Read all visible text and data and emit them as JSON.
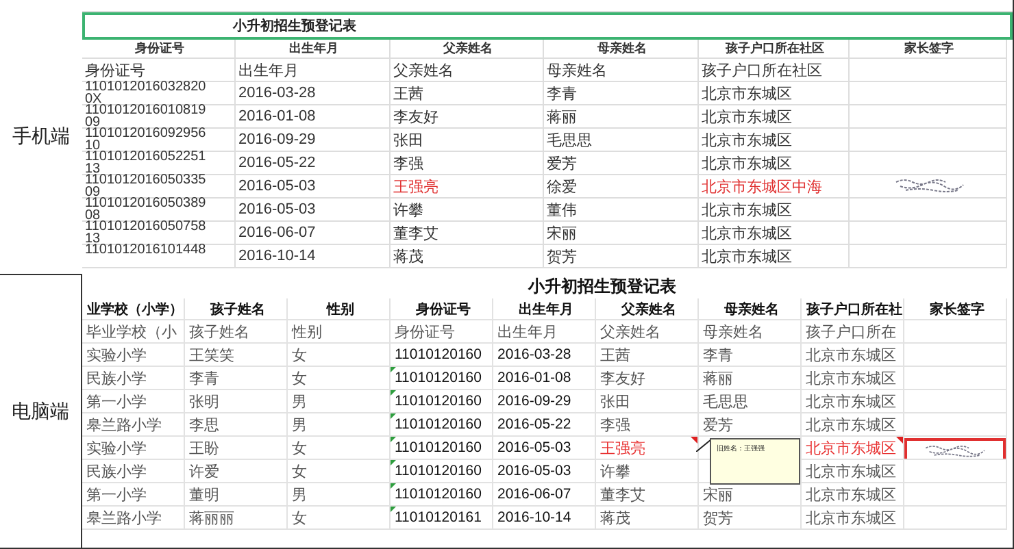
{
  "sections": [
    {
      "label": "手机端"
    },
    {
      "label": "电脑端"
    }
  ],
  "mobile_sheet": {
    "title": "小升初招生预登记表",
    "columns": [
      "身份证号",
      "出生年月",
      "父亲姓名",
      "母亲姓名",
      "孩子户口所在社区",
      "家长签字"
    ],
    "header_row": [
      "身份证号",
      "出生年月",
      "父亲姓名",
      "母亲姓名",
      "孩子户口所在社区"
    ],
    "rows": [
      {
        "id": "11010120160328200X",
        "birth": "2016-03-28",
        "father": "王茜",
        "mother": "李青",
        "community": "北京市东城区",
        "changed": false,
        "signed": false
      },
      {
        "id": "110101201601081909",
        "birth": "2016-01-08",
        "father": "李友好",
        "mother": "蒋丽",
        "community": "北京市东城区",
        "changed": false,
        "signed": false
      },
      {
        "id": "110101201609295610",
        "birth": "2016-09-29",
        "father": "张田",
        "mother": "毛思思",
        "community": "北京市东城区",
        "changed": false,
        "signed": false
      },
      {
        "id": "110101201605225113",
        "birth": "2016-05-22",
        "father": "李强",
        "mother": "爱芳",
        "community": "北京市东城区",
        "changed": false,
        "signed": false
      },
      {
        "id": "110101201605033509",
        "birth": "2016-05-03",
        "father": "王强亮",
        "mother": "徐爱",
        "community": "北京市东城区中海",
        "changed": true,
        "signed": true
      },
      {
        "id": "110101201605038908",
        "birth": "2016-05-03",
        "father": "许攀",
        "mother": "董伟",
        "community": "北京市东城区",
        "changed": false,
        "signed": false
      },
      {
        "id": "110101201605075813",
        "birth": "2016-06-07",
        "father": "董李艾",
        "mother": "宋丽",
        "community": "北京市东城区",
        "changed": false,
        "signed": false
      },
      {
        "id": "1101012016101448",
        "birth": "2016-10-14",
        "father": "蒋茂",
        "mother": "贺芳",
        "community": "北京市东城区",
        "changed": false,
        "signed": false
      }
    ]
  },
  "desktop_sheet": {
    "title": "小升初招生预登记表",
    "columns": [
      "业学校（小学）",
      "孩子姓名",
      "性别",
      "身份证号",
      "出生年月",
      "父亲姓名",
      "母亲姓名",
      "孩子户口所在社",
      "家长签字"
    ],
    "header_row": [
      "毕业学校（小",
      "孩子姓名",
      "性别",
      "身份证号",
      "出生年月",
      "父亲姓名",
      "母亲姓名",
      "孩子户口所在"
    ],
    "rows": [
      {
        "school": "实验小学",
        "child": "王笑笑",
        "gender": "女",
        "id": "11010120160",
        "birth": "2016-03-28",
        "father": "王茜",
        "mother": "李青",
        "community": "北京市东城区",
        "text_flag": false,
        "changed": false,
        "comment": false,
        "signed": false
      },
      {
        "school": "民族小学",
        "child": "李青",
        "gender": "女",
        "id": "11010120160",
        "birth": "2016-01-08",
        "father": "李友好",
        "mother": "蒋丽",
        "community": "北京市东城区",
        "text_flag": true,
        "changed": false,
        "comment": false,
        "signed": false
      },
      {
        "school": "第一小学",
        "child": "张明",
        "gender": "男",
        "id": "11010120160",
        "birth": "2016-09-29",
        "father": "张田",
        "mother": "毛思思",
        "community": "北京市东城区",
        "text_flag": true,
        "changed": false,
        "comment": false,
        "signed": false
      },
      {
        "school": "皋兰路小学",
        "child": "李思",
        "gender": "男",
        "id": "11010120160",
        "birth": "2016-05-22",
        "father": "李强",
        "mother": "爱芳",
        "community": "北京市东城区",
        "text_flag": true,
        "changed": false,
        "comment": false,
        "signed": false
      },
      {
        "school": "实验小学",
        "child": "王盼",
        "gender": "女",
        "id": "11010120160",
        "birth": "2016-05-03",
        "father": "王强亮",
        "community": "北京市东城区",
        "text_flag": true,
        "changed": true,
        "comment": true,
        "signed": true
      },
      {
        "school": "民族小学",
        "child": "许爱",
        "gender": "女",
        "id": "11010120160",
        "birth": "2016-05-03",
        "father": "许攀",
        "community": "北京市东城区",
        "text_flag": true,
        "changed": false,
        "comment": false,
        "signed": false
      },
      {
        "school": "第一小学",
        "child": "董明",
        "gender": "男",
        "id": "11010120160",
        "birth": "2016-06-07",
        "father": "董李艾",
        "mother": "宋丽",
        "community": "北京市东城区",
        "text_flag": true,
        "changed": false,
        "comment": false,
        "signed": false
      },
      {
        "school": "皋兰路小学",
        "child": "蒋丽丽",
        "gender": "女",
        "id": "11010120161",
        "birth": "2016-10-14",
        "father": "蒋茂",
        "mother": "贺芳",
        "community": "北京市东城区",
        "text_flag": true,
        "changed": false,
        "comment": false,
        "signed": false
      }
    ],
    "comment_note": {
      "text": "旧姓名：王强强"
    }
  }
}
